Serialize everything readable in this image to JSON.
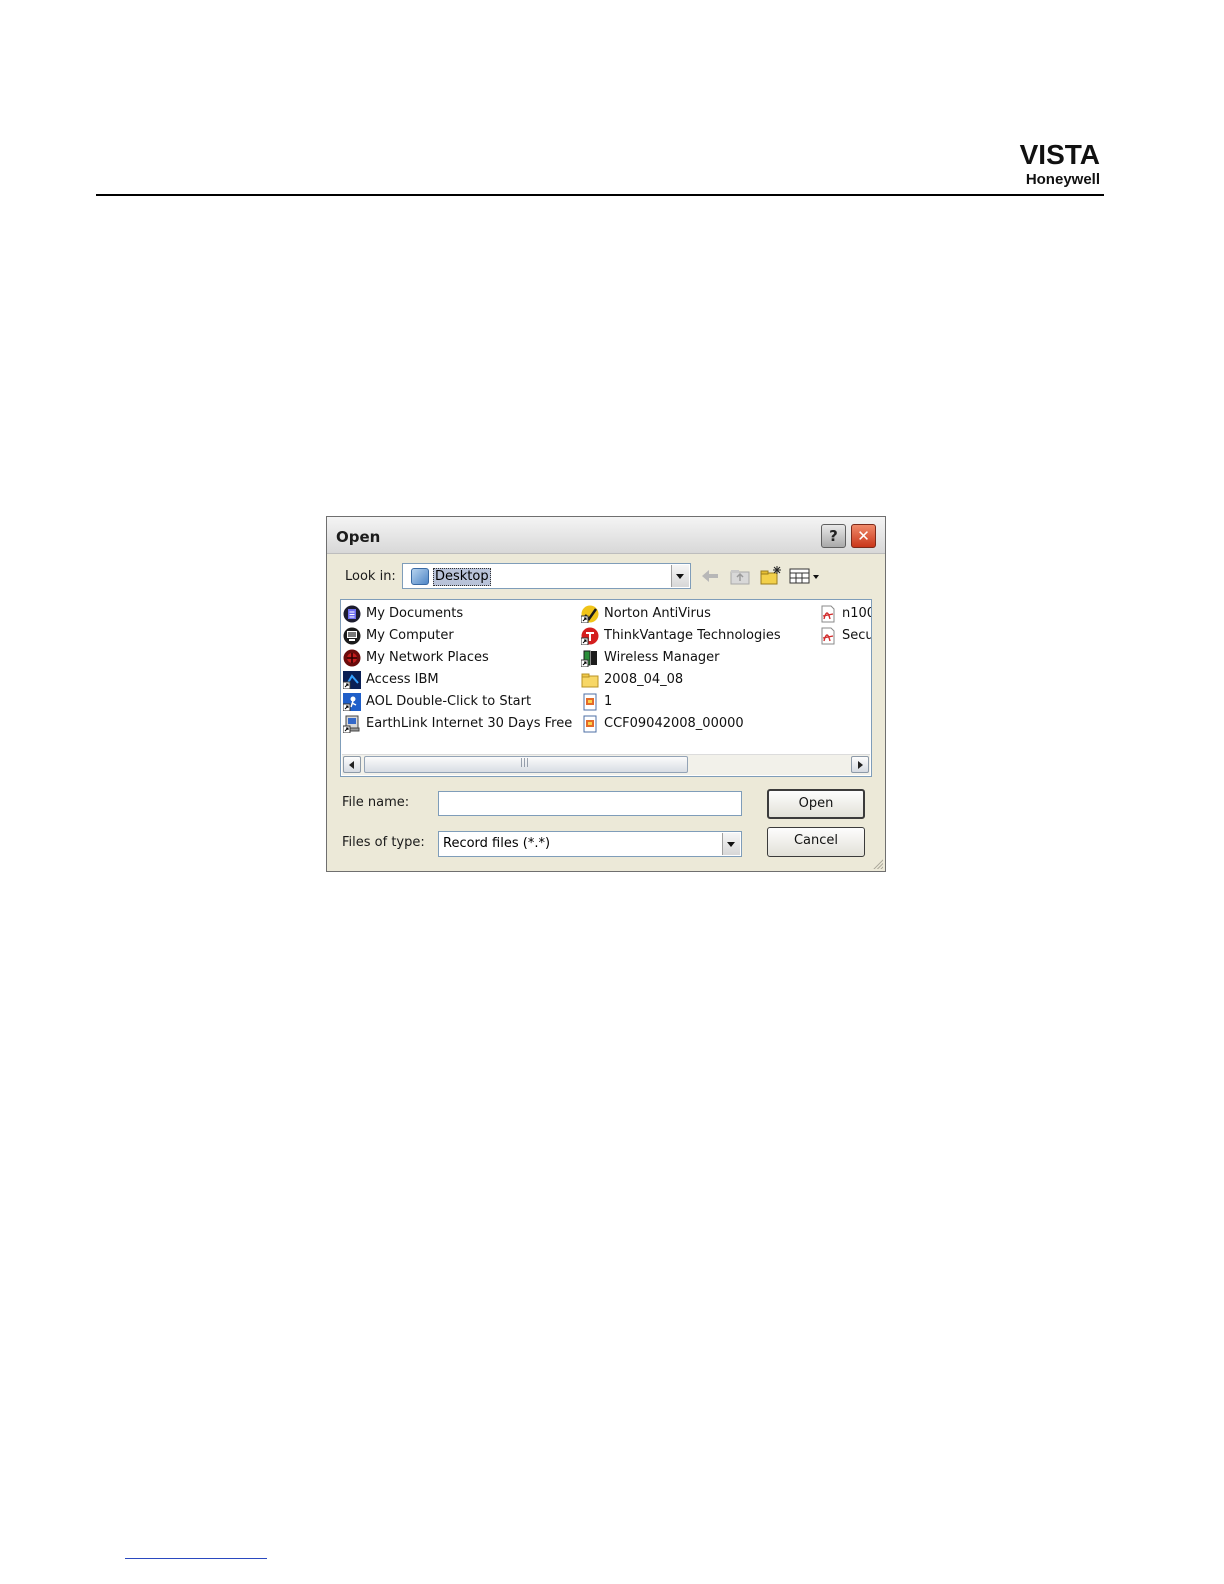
{
  "header": {
    "brand": "VISTA",
    "company": "Honeywell"
  },
  "dialog": {
    "title": "Open",
    "help_glyph": "?",
    "close_glyph": "✕",
    "look_in_label": "Look in:",
    "look_in_value": "Desktop",
    "files": [
      {
        "name": "My Documents",
        "icon": "my-documents-icon"
      },
      {
        "name": "My Computer",
        "icon": "my-computer-icon"
      },
      {
        "name": "My Network Places",
        "icon": "network-places-icon"
      },
      {
        "name": "Access IBM",
        "icon": "access-ibm-shortcut-icon"
      },
      {
        "name": "AOL Double-Click to Start",
        "icon": "aol-shortcut-icon"
      },
      {
        "name": "EarthLink Internet 30 Days Free",
        "icon": "earthlink-shortcut-icon"
      },
      {
        "name": "Norton AntiVirus",
        "icon": "norton-antivirus-icon"
      },
      {
        "name": "ThinkVantage Technologies",
        "icon": "thinkvantage-icon"
      },
      {
        "name": "Wireless Manager",
        "icon": "wireless-manager-icon"
      },
      {
        "name": "2008_04_08",
        "icon": "folder-icon"
      },
      {
        "name": "1",
        "icon": "record-file-icon"
      },
      {
        "name": "CCF09042008_00000",
        "icon": "record-file-icon"
      },
      {
        "name": "n100",
        "icon": "pdf-icon"
      },
      {
        "name": "Secu",
        "icon": "pdf-icon"
      }
    ],
    "file_name_label": "File name:",
    "file_name_value": "",
    "file_type_label": "Files of type:",
    "file_type_value": "Record files (*.*)",
    "open_button": "Open",
    "cancel_button": "Cancel",
    "colors": {
      "title_bar": "#e4e4e4",
      "close_button": "#d9482b",
      "dialog_face": "#ece9d8",
      "selection": "#b9c3d9"
    }
  }
}
